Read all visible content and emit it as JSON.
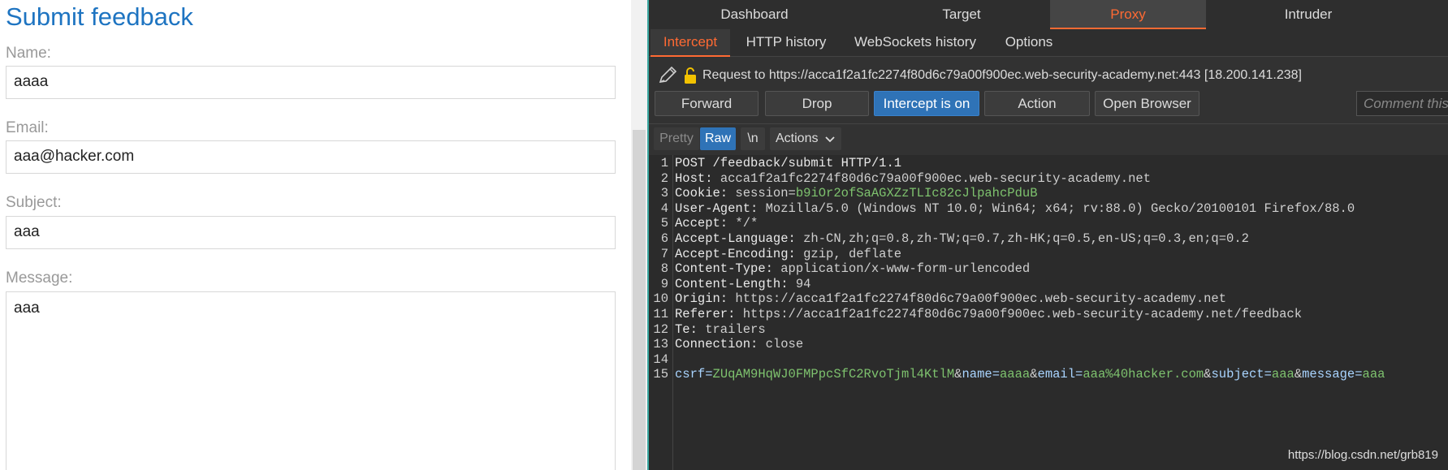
{
  "form": {
    "title": "Submit feedback",
    "name_label": "Name:",
    "name_value": "aaaa",
    "email_label": "Email:",
    "email_value": "aaa@hacker.com",
    "subject_label": "Subject:",
    "subject_value": "aaa",
    "message_label": "Message:",
    "message_value": "aaa"
  },
  "burp": {
    "top_tabs": [
      "Dashboard",
      "Target",
      "Proxy",
      "Intruder"
    ],
    "active_top_tab": "Proxy",
    "sub_tabs": [
      "Intercept",
      "HTTP history",
      "WebSockets history",
      "Options"
    ],
    "active_sub_tab": "Intercept",
    "request_info": "Request to https://acca1f2a1fc2274f80d6c79a00f900ec.web-security-academy.net:443  [18.200.141.238]",
    "buttons": {
      "forward": "Forward",
      "drop": "Drop",
      "intercept": "Intercept is on",
      "action": "Action",
      "open_browser": "Open Browser"
    },
    "comment_placeholder": "Comment this",
    "editor_toolbar": {
      "pretty": "Pretty",
      "raw": "Raw",
      "newline": "\\n",
      "actions": "Actions"
    },
    "request_lines": [
      {
        "n": "1",
        "key": "POST /feedback/submit HTTP/1.1",
        "val": ""
      },
      {
        "n": "2",
        "key": "Host:",
        "val": " acca1f2a1fc2274f80d6c79a00f900ec.web-security-academy.net"
      },
      {
        "n": "3",
        "key": "Cookie:",
        "val": " session="
      },
      {
        "n": "4",
        "key": "User-Agent:",
        "val": " Mozilla/5.0 (Windows NT 10.0; Win64; x64; rv:88.0) Gecko/20100101 Firefox/88.0"
      },
      {
        "n": "5",
        "key": "Accept:",
        "val": " */*"
      },
      {
        "n": "6",
        "key": "Accept-Language:",
        "val": " zh-CN,zh;q=0.8,zh-TW;q=0.7,zh-HK;q=0.5,en-US;q=0.3,en;q=0.2"
      },
      {
        "n": "7",
        "key": "Accept-Encoding:",
        "val": " gzip, deflate"
      },
      {
        "n": "8",
        "key": "Content-Type:",
        "val": " application/x-www-form-urlencoded"
      },
      {
        "n": "9",
        "key": "Content-Length:",
        "val": " 94"
      },
      {
        "n": "10",
        "key": "Origin:",
        "val": " https://acca1f2a1fc2274f80d6c79a00f900ec.web-security-academy.net"
      },
      {
        "n": "11",
        "key": "Referer:",
        "val": " https://acca1f2a1fc2274f80d6c79a00f900ec.web-security-academy.net/feedback"
      },
      {
        "n": "12",
        "key": "Te:",
        "val": " trailers"
      },
      {
        "n": "13",
        "key": "Connection:",
        "val": " close"
      },
      {
        "n": "14",
        "key": "",
        "val": ""
      }
    ],
    "session_value": "b9iOr2ofSaAGXZzTLIc82cJlpahcPduB",
    "body_line_number": "15",
    "body_params": [
      {
        "name": "csrf",
        "value": "ZUqAM9HqWJ0FMPpcSfC2RvoTjml4KtlM"
      },
      {
        "name": "name",
        "value": "aaaa"
      },
      {
        "name": "email",
        "value": "aaa%40hacker.com"
      },
      {
        "name": "subject",
        "value": "aaa"
      },
      {
        "name": "message",
        "value": "aaa"
      }
    ]
  },
  "watermark": "https://blog.csdn.net/grb819",
  "colors": {
    "accent": "#ff6a33",
    "primary_button": "#2f73b7",
    "title_blue": "#1e74c1",
    "param_value_green": "#7ec26e"
  }
}
